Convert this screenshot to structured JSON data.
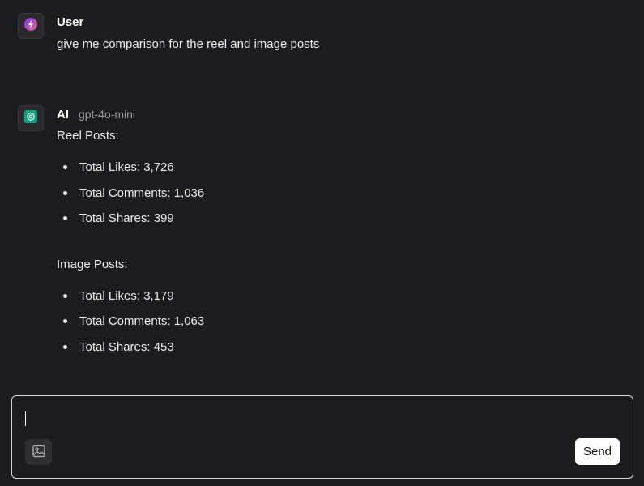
{
  "messages": {
    "user": {
      "sender": "User",
      "avatar_icon": "lightning-bolt-icon",
      "text": "give me comparison for the reel and image posts"
    },
    "ai": {
      "sender": "AI",
      "model": "gpt-4o-mini",
      "avatar_icon": "openai-logo-icon",
      "sections": [
        {
          "title": "Reel Posts:",
          "items": [
            "Total Likes: 3,726",
            "Total Comments: 1,036",
            "Total Shares: 399"
          ]
        },
        {
          "title": "Image Posts:",
          "items": [
            "Total Likes: 3,179",
            "Total Comments: 1,063",
            "Total Shares: 453"
          ]
        }
      ]
    }
  },
  "composer": {
    "input_value": "",
    "image_button_icon": "image-icon",
    "send_label": "Send"
  },
  "colors": {
    "background": "#1c1c1e",
    "ai_avatar_green": "#10a37f",
    "user_avatar_gradient": [
      "#7b3fe4",
      "#e85d9a"
    ]
  }
}
